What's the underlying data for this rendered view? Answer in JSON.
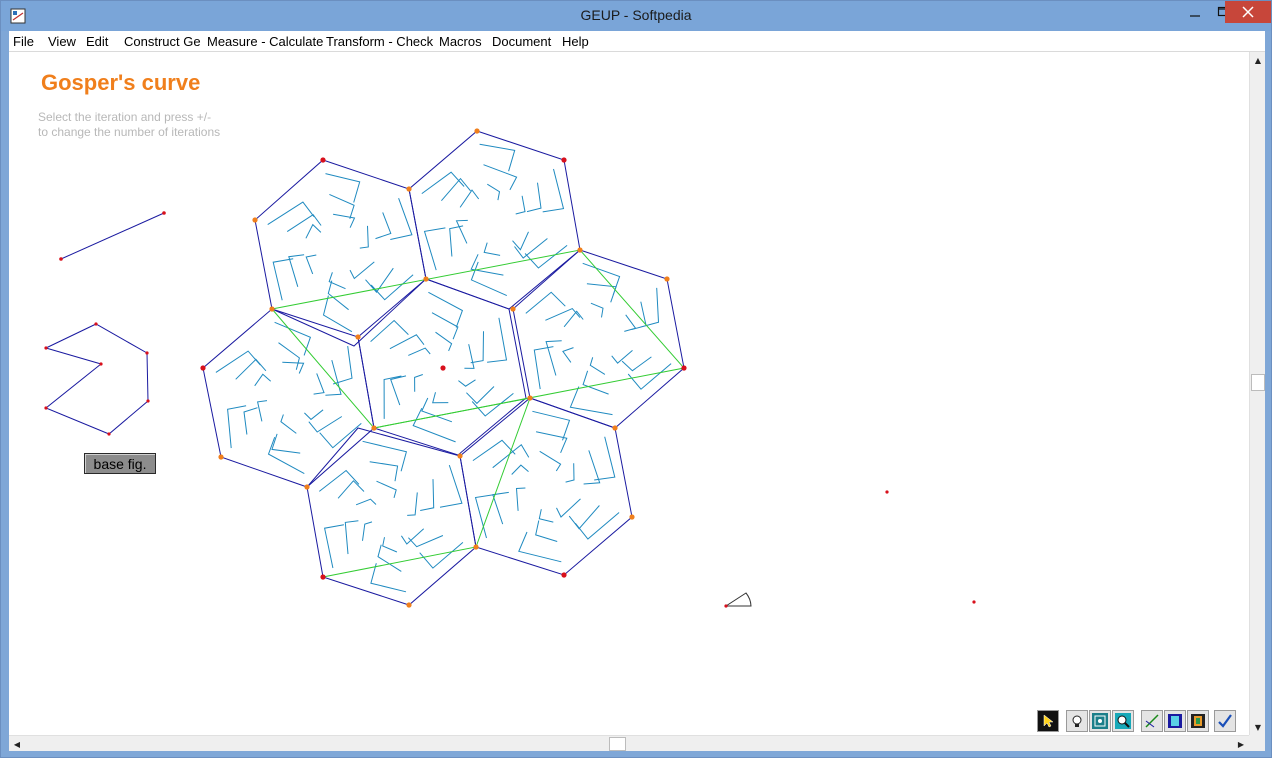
{
  "window": {
    "title": "GEUP - Softpedia"
  },
  "menu": {
    "items": [
      "File",
      "View",
      "Edit",
      "Construct Ge",
      "Measure - Calculate",
      "Transform - Check",
      "Macros",
      "Document",
      "Help"
    ]
  },
  "document": {
    "title": "Gosper's curve",
    "hint_line1": "Select the iteration and press +/-",
    "hint_line2": "to change the number of iterations",
    "base_button": "base fig."
  },
  "toolbar": {
    "tools": [
      "pointer-tool-icon",
      "hint-bulb-icon",
      "fit-view-icon",
      "zoom-icon",
      "construct-line-icon",
      "film-icon",
      "film-strip-icon",
      "check-icon"
    ]
  },
  "colors": {
    "title": "#f07f1c",
    "hexagon": "#1a1aa0",
    "curve": "#1f8ac0",
    "green": "#33cc33",
    "point_orange": "#f07f1c",
    "point_red": "#d8101c"
  }
}
